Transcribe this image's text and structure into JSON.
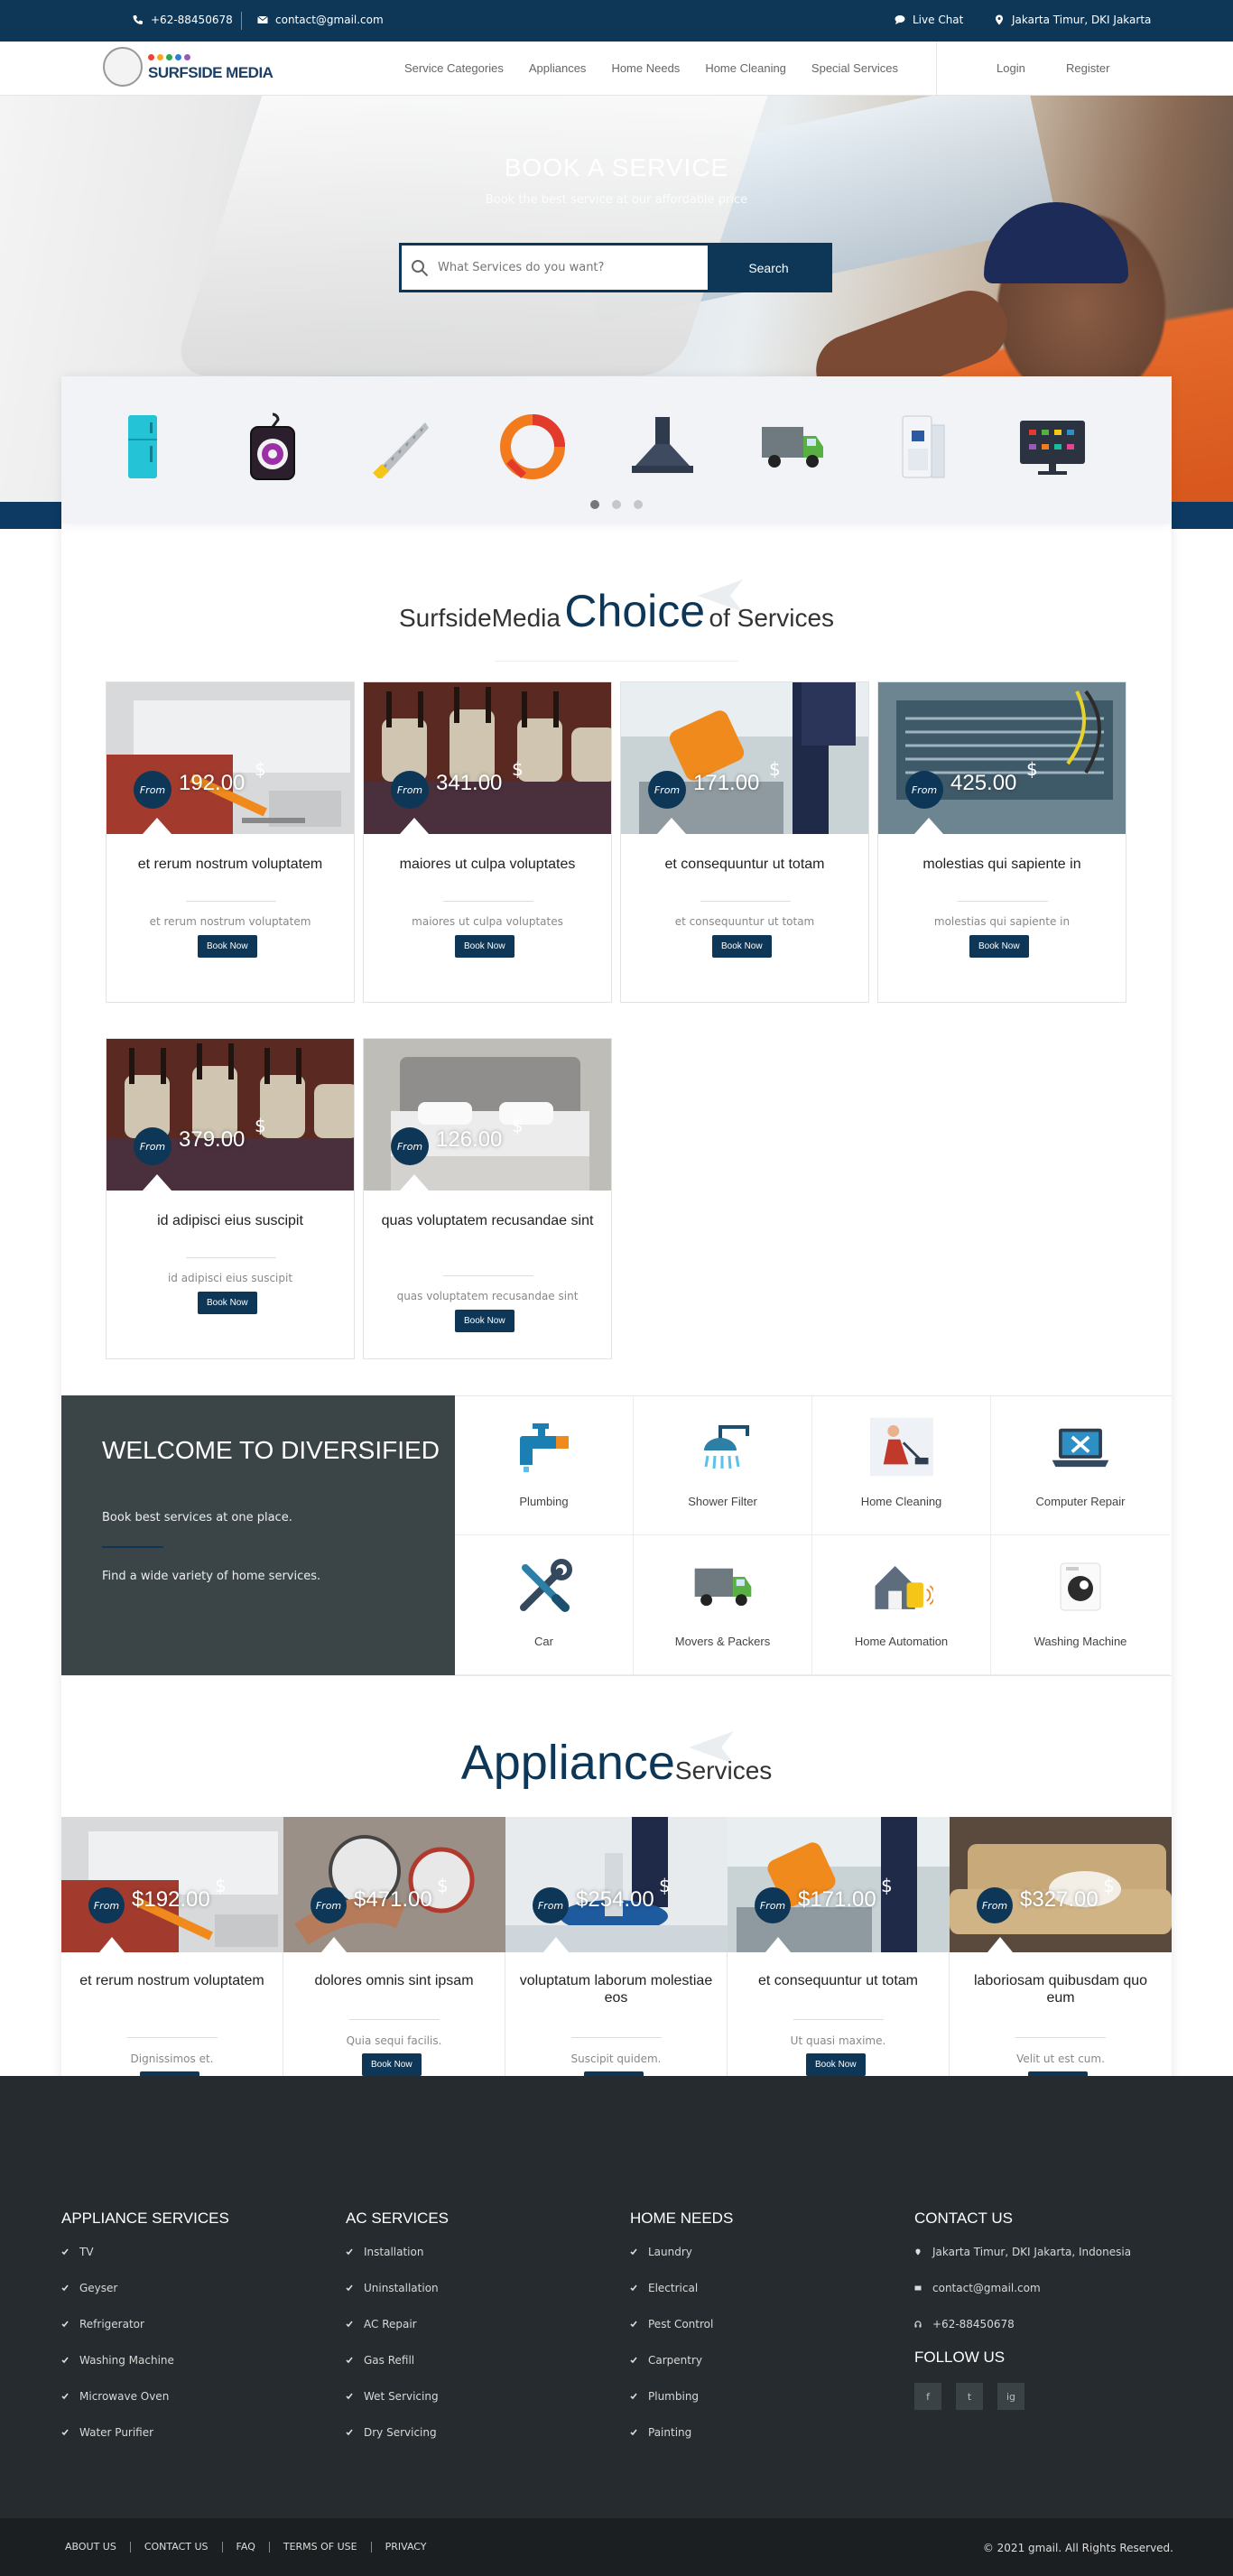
{
  "topbar": {
    "phone": "+62-88450678",
    "email": "contact@gmail.com",
    "live_chat": "Live Chat",
    "location": "Jakarta Timur, DKI Jakarta"
  },
  "header": {
    "logo_text": "SURFSIDE MEDIA",
    "nav": [
      "Service Categories",
      "Appliances",
      "Home Needs",
      "Home Cleaning",
      "Special Services"
    ],
    "login": "Login",
    "register": "Register"
  },
  "hero": {
    "title": "BOOK A SERVICE",
    "subtitle": "Book the best service at our affordable price",
    "search_placeholder": "What Services do you want?",
    "search_button": "Search"
  },
  "categories": {
    "icons": [
      "fridge-icon",
      "washing-machine-icon",
      "saw-icon",
      "color-wheel-icon",
      "chimney-hood-icon",
      "truck-icon",
      "air-purifier-icon",
      "tv-icon"
    ],
    "page_dots": 3,
    "active_dot": 0
  },
  "choice": {
    "prefix": "SurfsideMedia",
    "highlight": "Choice",
    "suffix": "of Services",
    "from_label": "From",
    "currency": "$",
    "button": "Book Now",
    "cards": [
      {
        "price": "192.00",
        "title": "et rerum nostrum voluptatem",
        "desc": "et rerum nostrum voluptatem",
        "image": "ac-tools"
      },
      {
        "price": "341.00",
        "title": "maiores ut culpa voluptates",
        "desc": "maiores ut culpa voluptates",
        "image": "chairs"
      },
      {
        "price": "171.00",
        "title": "et consequuntur ut totam",
        "desc": "et consequuntur ut totam",
        "image": "cleaning"
      },
      {
        "price": "425.00",
        "title": "molestias qui sapiente in",
        "desc": "molestias qui sapiente in",
        "image": "ac-open"
      },
      {
        "price": "379.00",
        "title": "id adipisci eius suscipit",
        "desc": "id adipisci eius suscipit",
        "image": "chairs"
      },
      {
        "price": "126.00",
        "title": "quas voluptatem recusandae sint",
        "desc": "quas voluptatem recusandae sint",
        "image": "bed"
      }
    ]
  },
  "welcome": {
    "title": "WELCOME TO DIVERSIFIED",
    "line1": "Book best services at one place.",
    "line2": "Find a wide variety of home services."
  },
  "services": [
    {
      "label": "Plumbing",
      "icon": "tap-icon"
    },
    {
      "label": "Shower Filter",
      "icon": "shower-icon"
    },
    {
      "label": "Home Cleaning",
      "icon": "vacuum-icon"
    },
    {
      "label": "Computer Repair",
      "icon": "laptop-tools-icon"
    },
    {
      "label": "Car",
      "icon": "wrench-screwdriver-icon"
    },
    {
      "label": "Movers & Packers",
      "icon": "truck-icon"
    },
    {
      "label": "Home Automation",
      "icon": "smart-home-icon"
    },
    {
      "label": "Washing Machine",
      "icon": "washing-machine-icon"
    }
  ],
  "appliance": {
    "highlight": "Appliance",
    "suffix": "Services",
    "from_label": "From",
    "currency": "$",
    "button": "Book Now",
    "cards": [
      {
        "price": "$192.00",
        "title": "et rerum nostrum voluptatem",
        "desc": "Dignissimos et.",
        "image": "ac-tools"
      },
      {
        "price": "$471.00",
        "title": "dolores omnis sint ipsam",
        "desc": "Quia sequi facilis.",
        "image": "gauges"
      },
      {
        "price": "$254.00",
        "title": "voluptatum laborum molestiae eos",
        "desc": "Suscipit quidem.",
        "image": "floor"
      },
      {
        "price": "$171.00",
        "title": "et consequuntur ut totam",
        "desc": "Ut quasi maxime.",
        "image": "cleaning"
      },
      {
        "price": "$327.00",
        "title": "laboriosam quibusdam quo eum",
        "desc": "Velit ut est cum.",
        "image": "sofa"
      }
    ]
  },
  "footer": {
    "columns": [
      {
        "title": "APPLIANCE SERVICES",
        "items": [
          "TV",
          "Geyser",
          "Refrigerator",
          "Washing Machine",
          "Microwave Oven",
          "Water Purifier"
        ]
      },
      {
        "title": "AC SERVICES",
        "items": [
          "Installation",
          "Uninstallation",
          "AC Repair",
          "Gas Refill",
          "Wet Servicing",
          "Dry Servicing"
        ]
      },
      {
        "title": "HOME NEEDS",
        "items": [
          "Laundry",
          "Electrical",
          "Pest Control",
          "Carpentry",
          "Plumbing",
          "Painting"
        ]
      }
    ],
    "contact": {
      "title": "CONTACT US",
      "address": "Jakarta Timur, DKI Jakarta, Indonesia",
      "email": "contact@gmail.com",
      "phone": "+62-88450678"
    },
    "follow_title": "FOLLOW US",
    "social": [
      "f",
      "t",
      "ig"
    ],
    "bottom_links": [
      "ABOUT US",
      "CONTACT US",
      "FAQ",
      "TERMS OF USE",
      "PRIVACY"
    ],
    "copyright": "© 2021 gmail. All Rights Reserved."
  },
  "colors": {
    "primary": "#0d3657",
    "dark_panel": "#3b4547",
    "footer": "#252b2e"
  }
}
